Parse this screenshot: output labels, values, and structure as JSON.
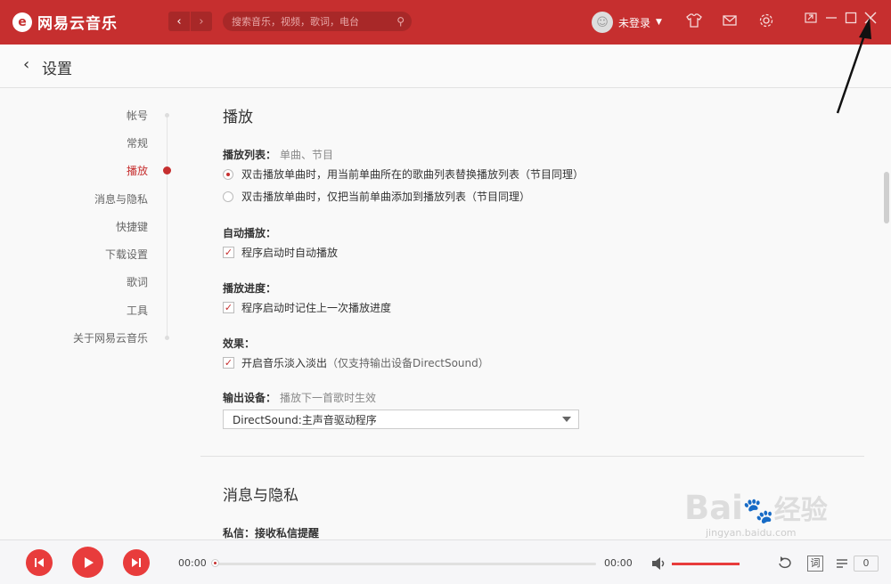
{
  "app": {
    "logo_mark": "e",
    "name": "网易云音乐"
  },
  "nav": {
    "back": "‹",
    "forward": "›"
  },
  "search": {
    "placeholder": "搜索音乐，视频，歌词，电台",
    "icon": "search-icon"
  },
  "user": {
    "name": "未登录",
    "avatar": "☺",
    "caret": "▼"
  },
  "toolbar_icons": [
    "shirt-icon",
    "mail-icon",
    "gear-icon"
  ],
  "window_controls": [
    "mini-mode-icon",
    "minimize-icon",
    "maximize-icon",
    "close-icon"
  ],
  "page": {
    "back_icon": "‹",
    "title": "设置"
  },
  "sidebar": {
    "items": [
      {
        "label": "帐号",
        "active": false
      },
      {
        "label": "常规",
        "active": false
      },
      {
        "label": "播放",
        "active": true
      },
      {
        "label": "消息与隐私",
        "active": false
      },
      {
        "label": "快捷键",
        "active": false
      },
      {
        "label": "下载设置",
        "active": false
      },
      {
        "label": "歌词",
        "active": false
      },
      {
        "label": "工具",
        "active": false
      },
      {
        "label": "关于网易云音乐",
        "active": false
      }
    ]
  },
  "play_section": {
    "title": "播放",
    "playlist_label": "播放列表：",
    "playlist_hint": "单曲、节目",
    "radio_options": [
      {
        "label": "双击播放单曲时，用当前单曲所在的歌曲列表替换播放列表（节目同理）",
        "selected": true
      },
      {
        "label": "双击播放单曲时，仅把当前单曲添加到播放列表（节目同理）",
        "selected": false
      }
    ],
    "autoplay_label": "自动播放：",
    "autoplay_option": "程序启动时自动播放",
    "autoplay_checked": true,
    "progress_label": "播放进度：",
    "progress_option": "程序启动时记住上一次播放进度",
    "progress_checked": true,
    "effect_label": "效果：",
    "effect_option": "开启音乐淡入淡出",
    "effect_note": "（仅支持输出设备DirectSound）",
    "effect_checked": true,
    "output_label": "输出设备：",
    "output_hint": "播放下一首歌时生效",
    "output_value": "DirectSound:主声音驱动程序"
  },
  "privacy_section": {
    "title": "消息与隐私",
    "message_label": "私信：",
    "message_hint": "接收私信提醒"
  },
  "player": {
    "current_time": "00:00",
    "total_time": "00:00",
    "progress": 0,
    "volume": 1.0,
    "lyric_label": "词",
    "playlist_count": "0"
  },
  "watermark": {
    "text": "Bai",
    "brand": "经验",
    "url": "jingyan.baidu.com"
  }
}
